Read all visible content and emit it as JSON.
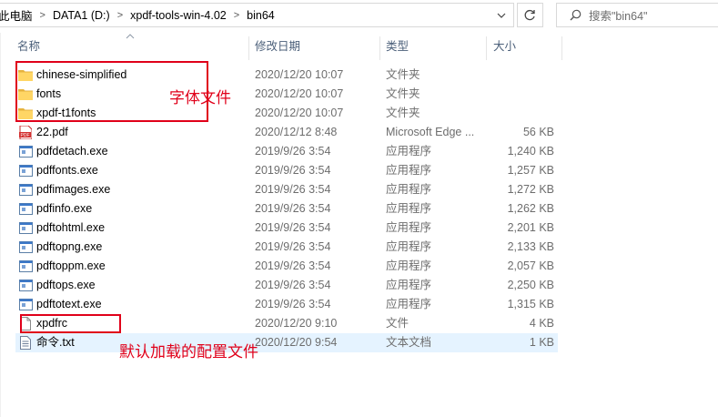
{
  "address": {
    "crumbs": [
      "此电脑",
      "DATA1 (D:)",
      "xpdf-tools-win-4.02",
      "bin64"
    ]
  },
  "search": {
    "placeholder": "搜索\"bin64\""
  },
  "columns": {
    "name": "名称",
    "date": "修改日期",
    "type": "类型",
    "size": "大小"
  },
  "files": [
    {
      "name": "chinese-simplified",
      "date": "2020/12/20 10:07",
      "type": "文件夹",
      "size": "",
      "icon": "folder-icon"
    },
    {
      "name": "fonts",
      "date": "2020/12/20 10:07",
      "type": "文件夹",
      "size": "",
      "icon": "folder-icon"
    },
    {
      "name": "xpdf-t1fonts",
      "date": "2020/12/20 10:07",
      "type": "文件夹",
      "size": "",
      "icon": "folder-icon"
    },
    {
      "name": "22.pdf",
      "date": "2020/12/12 8:48",
      "type": "Microsoft Edge ...",
      "size": "56 KB",
      "icon": "pdf-icon"
    },
    {
      "name": "pdfdetach.exe",
      "date": "2019/9/26 3:54",
      "type": "应用程序",
      "size": "1,240 KB",
      "icon": "exe-icon"
    },
    {
      "name": "pdffonts.exe",
      "date": "2019/9/26 3:54",
      "type": "应用程序",
      "size": "1,257 KB",
      "icon": "exe-icon"
    },
    {
      "name": "pdfimages.exe",
      "date": "2019/9/26 3:54",
      "type": "应用程序",
      "size": "1,272 KB",
      "icon": "exe-icon"
    },
    {
      "name": "pdfinfo.exe",
      "date": "2019/9/26 3:54",
      "type": "应用程序",
      "size": "1,262 KB",
      "icon": "exe-icon"
    },
    {
      "name": "pdftohtml.exe",
      "date": "2019/9/26 3:54",
      "type": "应用程序",
      "size": "2,201 KB",
      "icon": "exe-icon"
    },
    {
      "name": "pdftopng.exe",
      "date": "2019/9/26 3:54",
      "type": "应用程序",
      "size": "2,133 KB",
      "icon": "exe-icon"
    },
    {
      "name": "pdftoppm.exe",
      "date": "2019/9/26 3:54",
      "type": "应用程序",
      "size": "2,057 KB",
      "icon": "exe-icon"
    },
    {
      "name": "pdftops.exe",
      "date": "2019/9/26 3:54",
      "type": "应用程序",
      "size": "2,250 KB",
      "icon": "exe-icon"
    },
    {
      "name": "pdftotext.exe",
      "date": "2019/9/26 3:54",
      "type": "应用程序",
      "size": "1,315 KB",
      "icon": "exe-icon"
    },
    {
      "name": "xpdfrc",
      "date": "2020/12/20 9:10",
      "type": "文件",
      "size": "4 KB",
      "icon": "file-icon"
    },
    {
      "name": "命令.txt",
      "date": "2020/12/20 9:54",
      "type": "文本文档",
      "size": "1 KB",
      "icon": "txt-icon"
    }
  ],
  "annotations": {
    "fonts_label": "字体文件",
    "config_label": "默认加载的配置文件"
  },
  "colors": {
    "annotation": "#e0001a",
    "folder": "#ffd665",
    "selected_row": "#e5f3ff",
    "header_text": "#4c607a"
  }
}
